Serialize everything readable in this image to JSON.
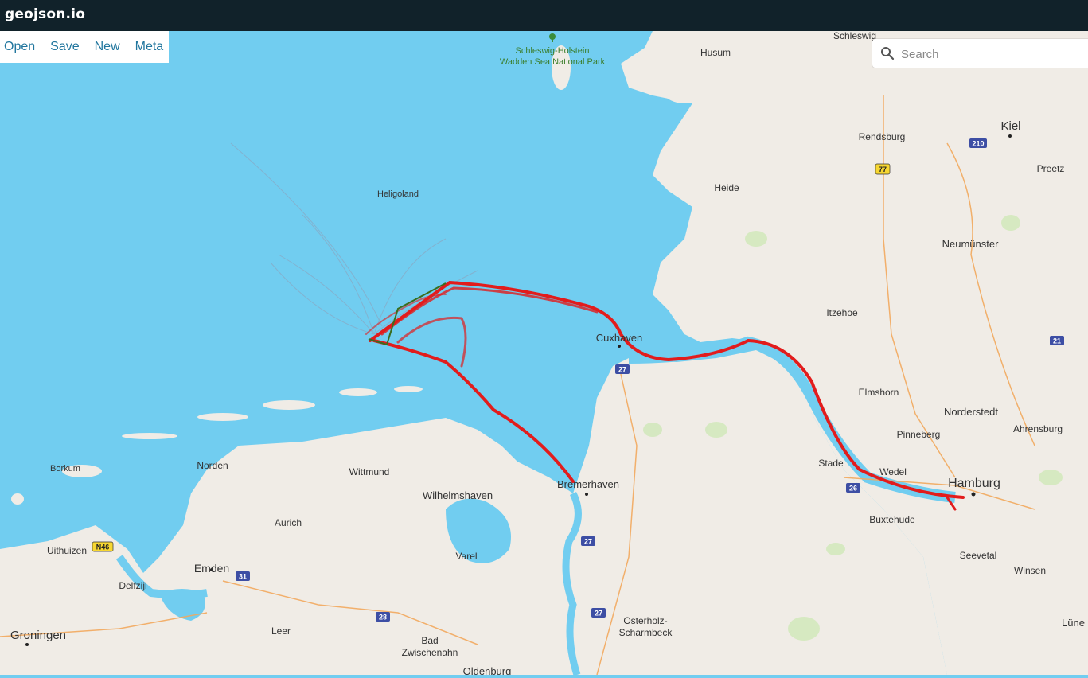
{
  "app": {
    "title": "geojson.io"
  },
  "menu": {
    "items": [
      "Open",
      "Save",
      "New",
      "Meta"
    ]
  },
  "search": {
    "placeholder": "Search"
  },
  "colors": {
    "water": "#71cdf0",
    "land": "#f0ece6",
    "route": "#e21c1c",
    "green_track": "#3a6d1e",
    "topbar": "#11222a"
  },
  "map": {
    "labels": {
      "schleswig": "Schleswig",
      "husum": "Husum",
      "park_line1": "Schleswig-Holstein",
      "park_line2": "Wadden Sea National Park",
      "kiel": "Kiel",
      "rendsburg": "Rendsburg",
      "preetz": "Preetz",
      "heligoland": "Heligoland",
      "heide": "Heide",
      "neumunster": "Neumünster",
      "itzehoe": "Itzehoe",
      "cuxhaven": "Cuxhaven",
      "elmshorn": "Elmshorn",
      "norderstedt": "Norderstedt",
      "ahrensburg": "Ahrensburg",
      "pinneberg": "Pinneberg",
      "stade": "Stade",
      "wedel": "Wedel",
      "hamburg": "Hamburg",
      "buxtehude": "Buxtehude",
      "seevetal": "Seevetal",
      "winsen": "Winsen",
      "luneburg": "Lüne",
      "borkum": "Borkum",
      "norden": "Norden",
      "wittmund": "Wittmund",
      "wilhelmshaven": "Wilhelmshaven",
      "bremerhaven": "Bremerhaven",
      "aurich": "Aurich",
      "varel": "Varel",
      "emden": "Emden",
      "uithuizen": "Uithuizen",
      "delfzijl": "Delfzijl",
      "groningen": "Groningen",
      "leer": "Leer",
      "bad_line1": "Bad",
      "bad_line2": "Zwischenahn",
      "osterholz_line1": "Osterholz-",
      "osterholz_line2": "Scharmbeck",
      "oldenburg": "Oldenburg"
    },
    "shields": [
      "210",
      "77",
      "21",
      "27",
      "26",
      "27",
      "27",
      "N46",
      "31",
      "28"
    ],
    "icons": [
      "park-tree-icon",
      "search-icon"
    ]
  }
}
